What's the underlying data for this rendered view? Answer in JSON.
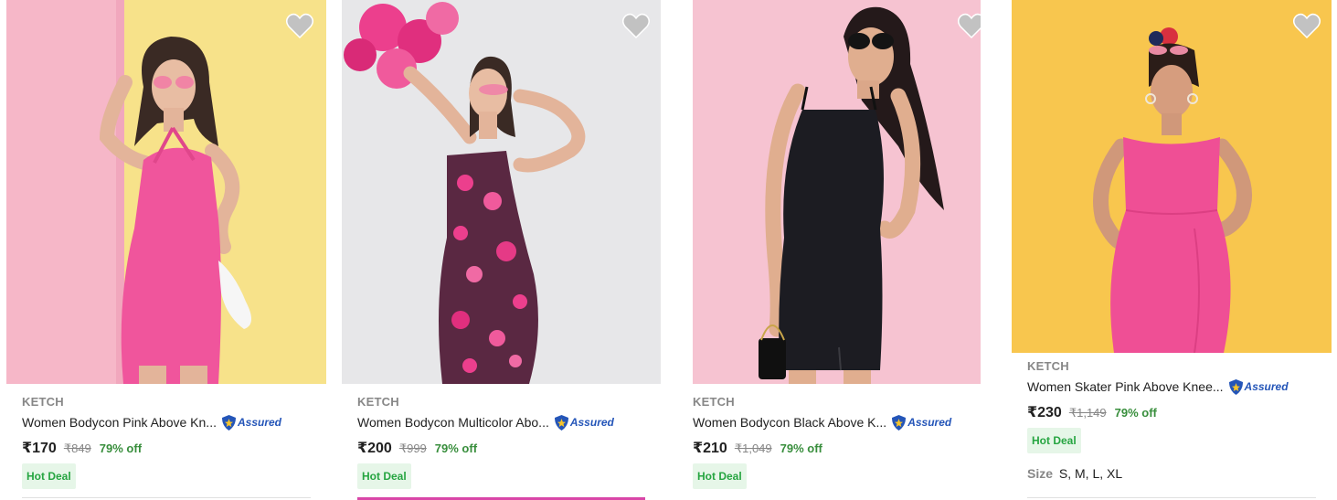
{
  "products": [
    {
      "brand": "KETCH",
      "title": "Women Bodycon Pink Above Kn...",
      "assured": "Assured",
      "price": "₹170",
      "mrp": "₹849",
      "discount": "79% off",
      "badge": "Hot Deal",
      "image_colors": {
        "bg_left": "#f6b7c8",
        "bg_right": "#f7e28a",
        "dress": "#f0559c"
      }
    },
    {
      "brand": "KETCH",
      "title": "Women Bodycon Multicolor Abo...",
      "assured": "Assured",
      "price": "₹200",
      "mrp": "₹999",
      "discount": "79% off",
      "badge": "Hot Deal",
      "image_colors": {
        "bg": "#e7e7e9",
        "dress": "#5a2842",
        "flowers": "#ec3f8d"
      }
    },
    {
      "brand": "KETCH",
      "title": "Women Bodycon Black Above K...",
      "assured": "Assured",
      "price": "₹210",
      "mrp": "₹1,049",
      "discount": "79% off",
      "badge": "Hot Deal",
      "image_colors": {
        "bg": "#f6c3d1",
        "dress": "#1c1c22"
      }
    },
    {
      "brand": "KETCH",
      "title": "Women Skater Pink Above Knee...",
      "assured": "Assured",
      "price": "₹230",
      "mrp": "₹1,149",
      "discount": "79% off",
      "badge": "Hot Deal",
      "size_label": "Size",
      "size_values": "S, M, L, XL",
      "image_colors": {
        "bg": "#f8c64e",
        "dress": "#ef4f95"
      }
    }
  ],
  "icons": {
    "wishlist": "heart-icon",
    "assured": "assured-shield-icon"
  },
  "colors": {
    "discount": "#388e3c",
    "hot_deal_text": "#26a541",
    "hot_deal_bg": "#e6f6e8",
    "assured": "#2455b8",
    "wishlist": "#c2c2c2"
  }
}
